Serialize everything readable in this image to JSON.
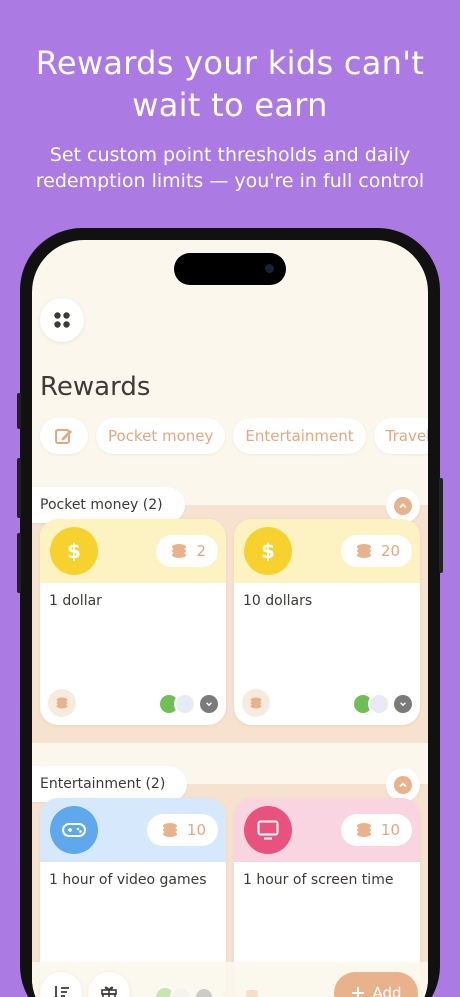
{
  "promo": {
    "headline_line1": "Rewards your kids can't",
    "headline_line2": "wait to earn",
    "sub_line1": "Set custom point thresholds and daily",
    "sub_line2": "redemption limits — you're in full control"
  },
  "app": {
    "title": "Rewards",
    "chips": [
      "Pocket money",
      "Entertainment",
      "Travel"
    ],
    "sections": [
      {
        "label": "Pocket money (2)",
        "cards": [
          {
            "icon": "dollar-icon",
            "symbol": "$",
            "points": "2",
            "name": "1 dollar",
            "top_color": "#fdf2c2",
            "circle_color": "#f7d22e"
          },
          {
            "icon": "dollar-icon",
            "symbol": "$",
            "points": "20",
            "name": "10 dollars",
            "top_color": "#fdf2c2",
            "circle_color": "#f7d22e"
          }
        ]
      },
      {
        "label": "Entertainment (2)",
        "cards": [
          {
            "icon": "gamepad-icon",
            "points": "10",
            "name": "1 hour of video games",
            "top_color": "#d6e8fb",
            "circle_color": "#5fa8ec"
          },
          {
            "icon": "tv-icon",
            "points": "10",
            "name": "1 hour of screen time",
            "top_color": "#f8d5e1",
            "circle_color": "#e9517e"
          }
        ]
      }
    ],
    "add_label": "Add"
  }
}
